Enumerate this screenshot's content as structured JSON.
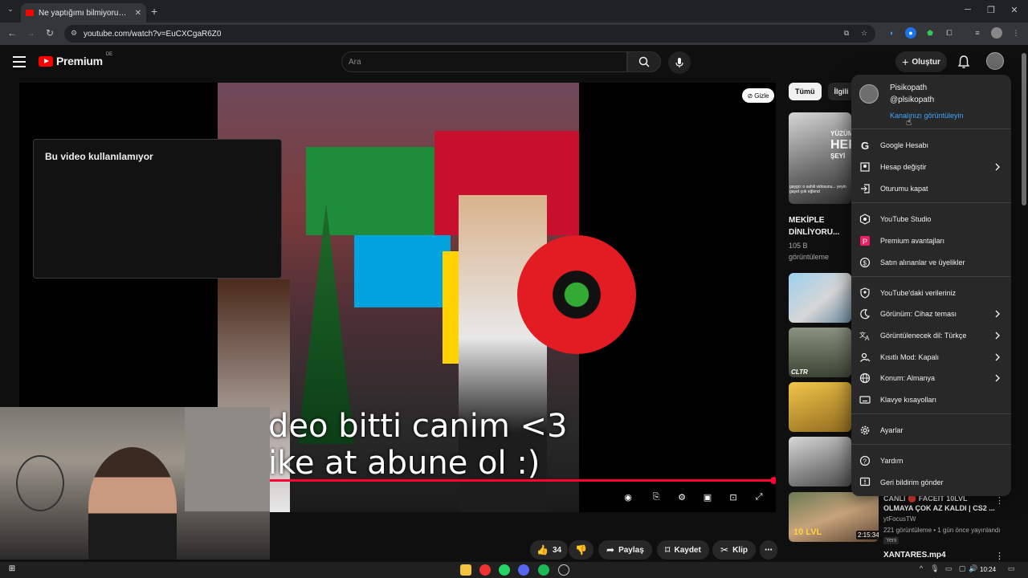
{
  "browser": {
    "tab_title": "Ne yaptığımı bilmiyorum [DİSC",
    "url": "youtube.com/watch?v=EuCXCgaR6Z0"
  },
  "header": {
    "brand": "Premium",
    "region": "DE",
    "search_placeholder": "Ara",
    "create_label": "Oluştur"
  },
  "player": {
    "unavailable_text": "Bu video kullanılamıyor",
    "hide_label": "Gizle",
    "subtitle_line1": "deo bitti canim <3",
    "subtitle_line2": "ike at abune ol :)",
    "progress_fraction": 0.97
  },
  "actions": {
    "like_count": "34",
    "share_label": "Paylaş",
    "save_label": "Kaydet",
    "clip_label": "Klip"
  },
  "chips": [
    {
      "label": "Tümü"
    },
    {
      "label": "İlgili"
    }
  ],
  "recommendations": {
    "item1": {
      "title_line1": "MEKİPLE",
      "title_line2": "DİNLİYORU...",
      "views": "105 B",
      "views_label": "görüntüleme",
      "thumb_text1": "YÜZÜM",
      "thumb_text2": "HER",
      "thumb_text3": "ŞEYİ",
      "thumb_caption": "gaygo: o sahili vidosunu... yeyin gayet çok eğlend"
    },
    "item2": {
      "thumb_text": "CLTR"
    },
    "item3": {
      "title_line1": "CANLI 🔴 FACEIT 10LVL",
      "title_line2": "OLMAYA ÇOK AZ KALDI | CS2 ...",
      "channel": "ytFocusTW",
      "meta": "221 görüntüleme • 1 gün önce yayınlandı",
      "badge": "Yeni",
      "duration": "2:15:34",
      "thumb_text": "10 LVL"
    },
    "item4": {
      "title": "XANTARES.mp4"
    }
  },
  "account_menu": {
    "name": "Pisikopath",
    "handle": "@plsikopath",
    "channel_link": "Kanalınızı görüntüleyin",
    "items": [
      {
        "label": "Google Hesabı"
      },
      {
        "label": "Hesap değiştir"
      },
      {
        "label": "Oturumu kapat"
      },
      {
        "label": "YouTube Studio"
      },
      {
        "label": "Premium avantajları"
      },
      {
        "label": "Satın alınanlar ve üyelikler"
      },
      {
        "label": "YouTube'daki verileriniz"
      },
      {
        "label": "Görünüm: Cihaz teması"
      },
      {
        "label": "Görüntülenecek dil: Türkçe"
      },
      {
        "label": "Kısıtlı Mod: Kapalı"
      },
      {
        "label": "Konum: Almanya"
      },
      {
        "label": "Klavye kısayolları"
      },
      {
        "label": "Ayarlar"
      },
      {
        "label": "Yardım"
      },
      {
        "label": "Geri bildirim gönder"
      }
    ]
  },
  "taskbar": {
    "time": "10:24"
  },
  "colors": {
    "yt_red": "#ff0000",
    "progress": "#ff0033",
    "link": "#3ea6ff",
    "menu_bg": "#282828"
  }
}
